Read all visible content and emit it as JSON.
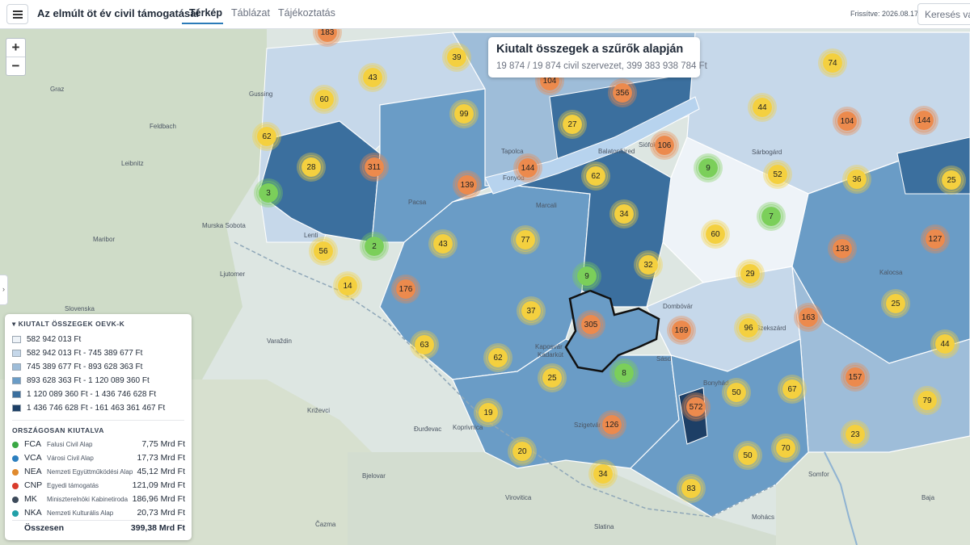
{
  "header": {
    "menu_icon": "hamburger-icon",
    "title": "Az elmúlt öt év civil támogatásai",
    "tabs": [
      {
        "label": "Térkép",
        "active": true
      },
      {
        "label": "Táblázat",
        "active": false
      },
      {
        "label": "Tájékoztatás",
        "active": false
      }
    ],
    "refresh": "Frissítve: 2026.08.17",
    "search_placeholder": "Keresés vála"
  },
  "map": {
    "zoom_in": "+",
    "zoom_out": "−",
    "side_toggle": "›",
    "clusters": [
      "183",
      "39",
      "43",
      "60",
      "62",
      "28",
      "311",
      "3",
      "99",
      "27",
      "356",
      "104",
      "144",
      "139",
      "2",
      "56",
      "14",
      "176",
      "43",
      "77",
      "34",
      "62",
      "9",
      "60",
      "7",
      "52",
      "36",
      "74",
      "104",
      "144",
      "44",
      "106",
      "25",
      "127",
      "133",
      "29",
      "9",
      "32",
      "37",
      "305",
      "169",
      "96",
      "163",
      "25",
      "63",
      "62",
      "25",
      "8",
      "572",
      "50",
      "67",
      "157",
      "44",
      "79",
      "19",
      "20",
      "126",
      "34",
      "50",
      "70",
      "23",
      "83"
    ],
    "places": [
      "Graz",
      "Gussing",
      "Feldbach",
      "Leibnitz",
      "Murska Sobota",
      "Maribor",
      "Ljutomer",
      "Varaždin",
      "Bjelovar",
      "Virovitica",
      "Đurđevac",
      "Križevci",
      "Čazma",
      "Slatina",
      "Mohács",
      "Kalocsa",
      "Sárbogárd",
      "Somfor",
      "Balatonfüred",
      "Siófok",
      "Fonyód",
      "Tapolca",
      "Pacsa",
      "Lenti",
      "Slovenska",
      "Marcali",
      "Szigetvár",
      "Kaposvár",
      "Bonyhád",
      "Dombóvár",
      "Szekszárd",
      "Koprivnica",
      "Kadarkút",
      "Sásd",
      "Baja"
    ]
  },
  "info": {
    "title": "Kiutalt összegek a szűrők alapján",
    "subtitle": "19 874 / 19 874 civil szervezet, 399 383 938 784 Ft"
  },
  "legend": {
    "heading": "KIUTALT ÖSSZEGEK OEVK-K",
    "collapse_icon": "caret-down-icon",
    "classes": [
      {
        "label": "582 942 013 Ft",
        "color": "#eef3f8"
      },
      {
        "label": "582 942 013 Ft - 745 389 677 Ft",
        "color": "#c6d8ea"
      },
      {
        "label": "745 389 677 Ft - 893 628 363 Ft",
        "color": "#9ebdd9"
      },
      {
        "label": "893 628 363 Ft - 1 120 089 360 Ft",
        "color": "#6a9cc6"
      },
      {
        "label": "1 120 089 360 Ft - 1 436 746 628 Ft",
        "color": "#3b6f9e"
      },
      {
        "label": "1 436 746 628 Ft - 161 463 361 467 Ft",
        "color": "#1d3f66"
      }
    ],
    "funds_heading": "ORSZÁGOSAN KIUTALVA",
    "funds": [
      {
        "code": "FCA",
        "name": "Falusi Civil Alap",
        "amount": "7,75 Mrd Ft",
        "color": "#3aa844"
      },
      {
        "code": "VCA",
        "name": "Városi Civil Alap",
        "amount": "17,73 Mrd Ft",
        "color": "#2c7fbf"
      },
      {
        "code": "NEA",
        "name": "Nemzeti Együttműködési Alap",
        "amount": "45,12 Mrd Ft",
        "color": "#e08a2e"
      },
      {
        "code": "CNP",
        "name": "Egyedi támogatás",
        "amount": "121,09 Mrd Ft",
        "color": "#d93b2b"
      },
      {
        "code": "MK",
        "name": "Miniszterelnöki Kabinetiroda",
        "amount": "186,96 Mrd Ft",
        "color": "#3d4a5a"
      },
      {
        "code": "NKA",
        "name": "Nemzeti Kulturális Alap",
        "amount": "20,73 Mrd Ft",
        "color": "#22a0a8"
      }
    ],
    "total_label": "Összesen",
    "total_amount": "399,38 Mrd Ft"
  },
  "colors": {
    "accent": "#2b7bb9",
    "cluster_yellow": "#f4d03f",
    "cluster_orange": "#ec8a4d",
    "cluster_green": "#7bcf5a"
  }
}
